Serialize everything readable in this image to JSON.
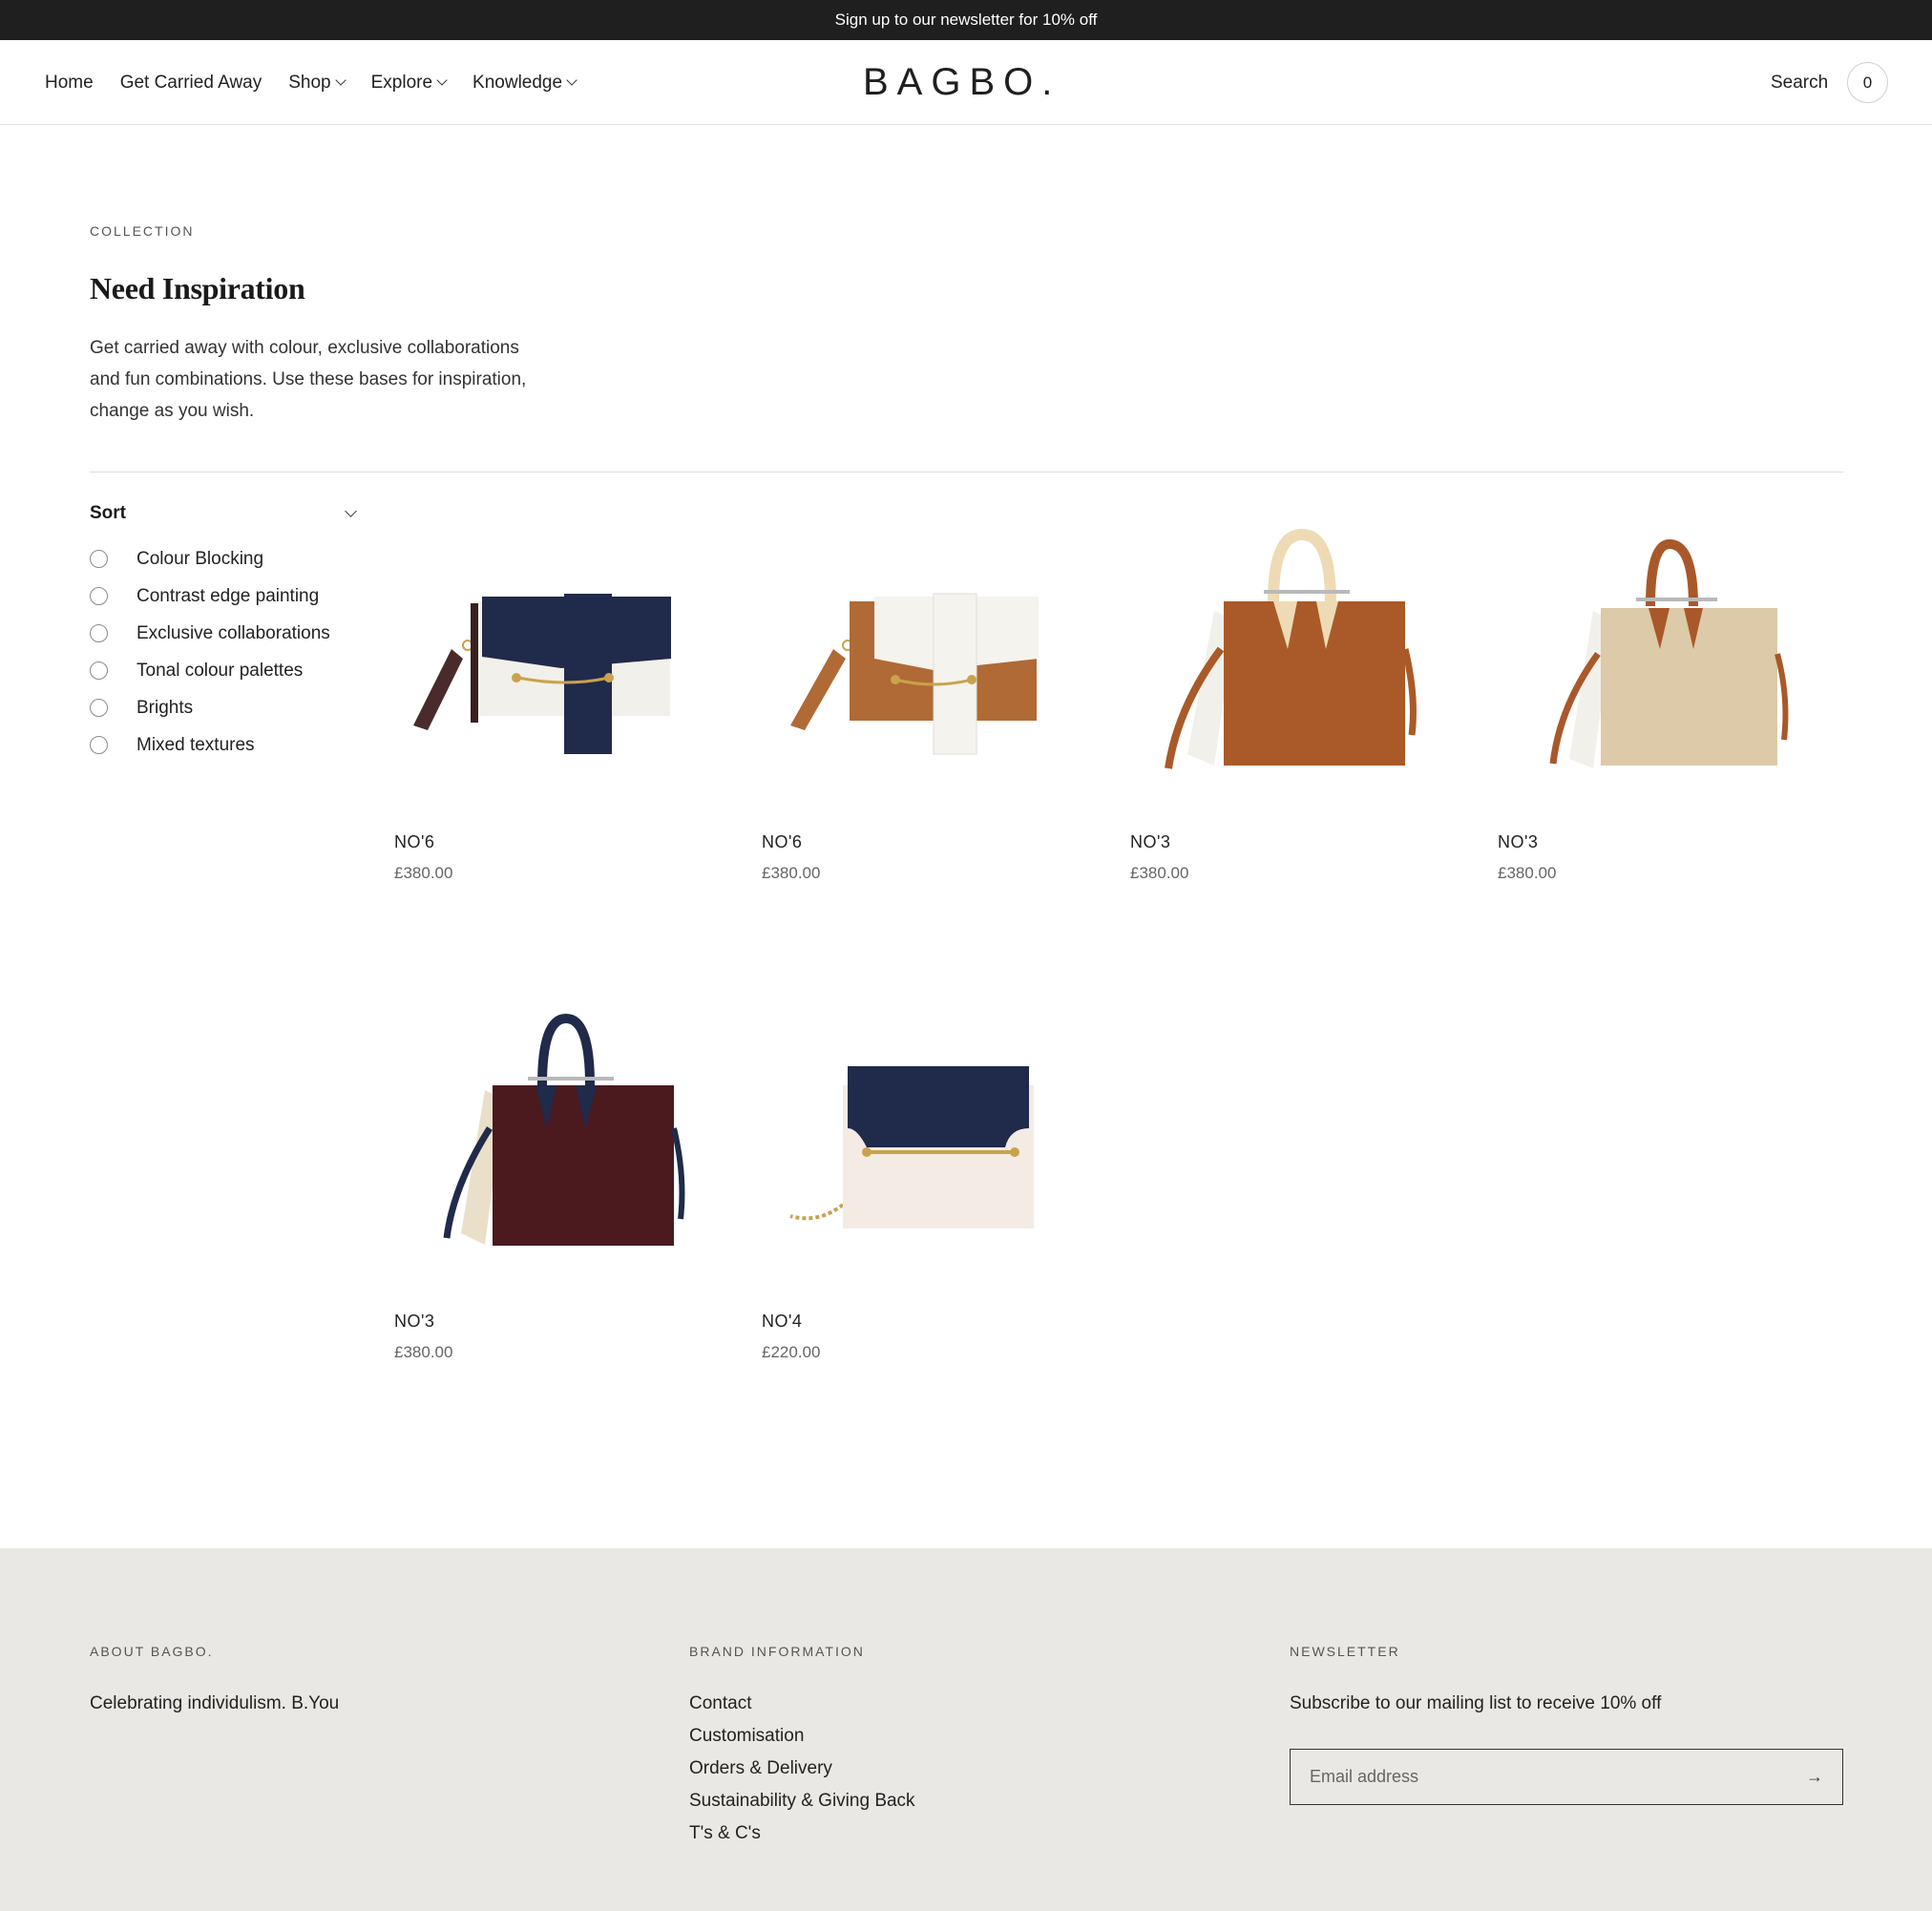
{
  "announcement": "Sign up to our newsletter for 10% off",
  "nav": {
    "items": [
      {
        "label": "Home"
      },
      {
        "label": "Get Carried Away"
      },
      {
        "label": "Shop"
      },
      {
        "label": "Explore"
      },
      {
        "label": "Knowledge"
      }
    ],
    "logo": "BAGBO.",
    "search": "Search",
    "cart_count": "0"
  },
  "collection": {
    "eyebrow": "COLLECTION",
    "title": "Need Inspiration",
    "description": "Get carried away with colour, exclusive collaborations and fun combinations. Use these bases for inspiration, change as you wish."
  },
  "sort": {
    "label": "Sort",
    "options": [
      {
        "label": "Colour Blocking"
      },
      {
        "label": "Contrast edge painting"
      },
      {
        "label": "Exclusive collaborations"
      },
      {
        "label": "Tonal colour palettes"
      },
      {
        "label": "Brights"
      },
      {
        "label": "Mixed textures"
      }
    ]
  },
  "products": [
    {
      "name": "NO'6",
      "price": "£380.00",
      "colors": {
        "main": "#f2f0ea",
        "accent": "#202a4a",
        "strap": "#4a2a2a"
      }
    },
    {
      "name": "NO'6",
      "price": "£380.00",
      "colors": {
        "main": "#f5f3ee",
        "accent": "#b06a35",
        "strap": "#b06a35"
      }
    },
    {
      "name": "NO'3",
      "price": "£380.00",
      "colors": {
        "main": "#a95a28",
        "accent": "#eedbb5",
        "strap": "#a95a28"
      }
    },
    {
      "name": "NO'3",
      "price": "£380.00",
      "colors": {
        "main": "#dccaa8",
        "accent": "#a9582a",
        "strap": "#a9582a"
      }
    },
    {
      "name": "NO'3",
      "price": "£380.00",
      "colors": {
        "main": "#4a1a1e",
        "accent": "#202a4a",
        "strap": "#202a4a"
      }
    },
    {
      "name": "NO'4",
      "price": "£220.00",
      "colors": {
        "main": "#f4ebe4",
        "accent": "#202a4a",
        "strap": "#c9a24e"
      }
    }
  ],
  "footer": {
    "about": {
      "heading": "ABOUT BAGBO.",
      "text": "Celebrating individulism. B.You"
    },
    "brand": {
      "heading": "BRAND INFORMATION",
      "links": [
        {
          "label": "Contact"
        },
        {
          "label": "Customisation"
        },
        {
          "label": "Orders & Delivery"
        },
        {
          "label": "Sustainability & Giving Back"
        },
        {
          "label": "T's & C's"
        }
      ]
    },
    "newsletter": {
      "heading": "NEWSLETTER",
      "text": "Subscribe to our mailing list to receive 10% off",
      "placeholder": "Email address"
    }
  }
}
